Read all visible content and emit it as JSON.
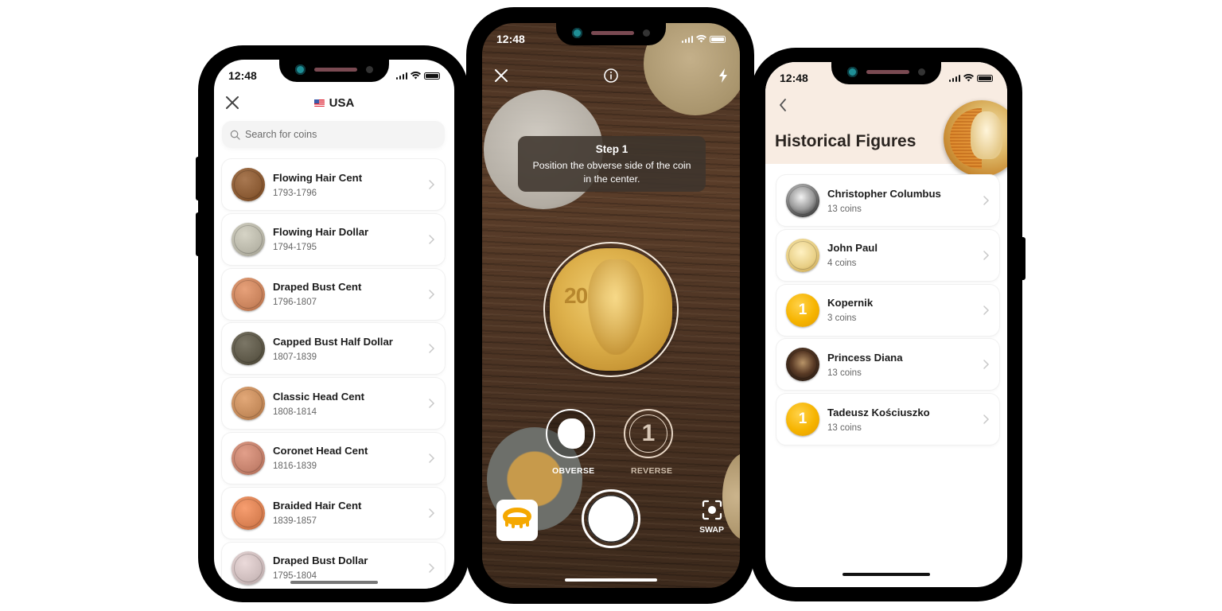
{
  "status_time": "12:48",
  "left_screen": {
    "title": "USA",
    "flag_icon": "us-flag-icon",
    "search_placeholder": "Search for coins",
    "coins": [
      {
        "name": "Flowing Hair Cent",
        "years": "1793-1796",
        "color": "#8a5a33"
      },
      {
        "name": "Flowing Hair Dollar",
        "years": "1794-1795",
        "color": "#b8b6a8"
      },
      {
        "name": "Draped Bust Cent",
        "years": "1796-1807",
        "color": "#c9835c"
      },
      {
        "name": "Capped Bust Half Dollar",
        "years": "1807-1839",
        "color": "#5d5848"
      },
      {
        "name": "Classic Head Cent",
        "years": "1808-1814",
        "color": "#c48a5a"
      },
      {
        "name": "Coronet Head Cent",
        "years": "1816-1839",
        "color": "#c4816c"
      },
      {
        "name": "Braided Hair Cent",
        "years": "1839-1857",
        "color": "#d98052"
      },
      {
        "name": "Draped Bust Dollar",
        "years": "1795-1804",
        "color": "#cdbcbc"
      }
    ]
  },
  "camera_screen": {
    "step_title": "Step 1",
    "step_text": "Position the obverse side of the coin in the center.",
    "coin_denomination": "20",
    "obverse_label": "OBVERSE",
    "reverse_label": "REVERSE",
    "reverse_glyph": "1",
    "swap_label": "SWAP",
    "accent_color": "#f5a800"
  },
  "right_screen": {
    "title": "Historical Figures",
    "figures": [
      {
        "name": "Christopher Columbus",
        "count": "13 coins",
        "coin_style": "silver"
      },
      {
        "name": "John Paul",
        "count": "4 coins",
        "coin_style": "gold-portrait"
      },
      {
        "name": "Kopernik",
        "count": "3 coins",
        "coin_style": "placeholder",
        "glyph": "1"
      },
      {
        "name": "Princess Diana",
        "count": "13 coins",
        "coin_style": "dark-portrait"
      },
      {
        "name": "Tadeusz Kościuszko",
        "count": "13 coins",
        "coin_style": "placeholder",
        "glyph": "1"
      }
    ]
  }
}
